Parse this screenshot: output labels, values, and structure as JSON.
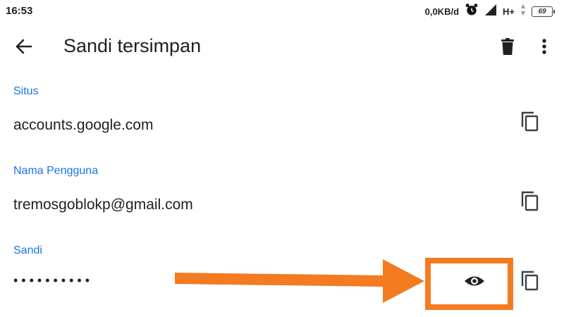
{
  "status_bar": {
    "time": "16:53",
    "net_speed": "0,0KB/d",
    "network_type": "H+",
    "battery_level": "69"
  },
  "toolbar": {
    "title": "Sandi tersimpan",
    "back_icon": "arrow-back-icon",
    "delete_icon": "trash-icon",
    "menu_icon": "more-vert-icon"
  },
  "site": {
    "label": "Situs",
    "value": "accounts.google.com"
  },
  "username": {
    "label": "Nama Pengguna",
    "value": "tremosgoblokp@gmail.com"
  },
  "password": {
    "label": "Sandi",
    "masked_value": "••••••••••"
  },
  "colors": {
    "label_blue": "#1a73e8",
    "annotation_orange": "#f47b20",
    "text": "#202124",
    "icon": "#3c4043"
  }
}
